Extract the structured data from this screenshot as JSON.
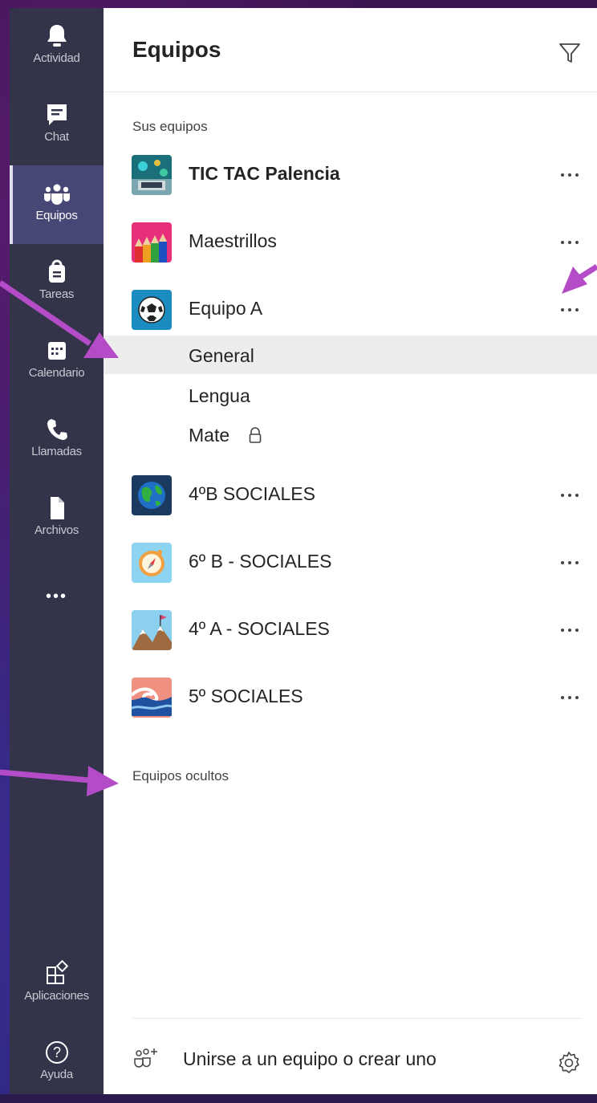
{
  "rail": {
    "items": [
      {
        "label": "Actividad",
        "icon": "bell-icon"
      },
      {
        "label": "Chat",
        "icon": "chat-icon"
      },
      {
        "label": "Equipos",
        "icon": "teams-icon"
      },
      {
        "label": "Tareas",
        "icon": "assignments-icon"
      },
      {
        "label": "Calendario",
        "icon": "calendar-icon"
      },
      {
        "label": "Llamadas",
        "icon": "phone-icon"
      },
      {
        "label": "Archivos",
        "icon": "file-icon"
      }
    ],
    "more_label": "•••",
    "bottom": [
      {
        "label": "Aplicaciones",
        "icon": "apps-icon"
      },
      {
        "label": "Ayuda",
        "icon": "help-icon"
      }
    ]
  },
  "panel": {
    "title": "Equipos",
    "your_teams_label": "Sus equipos",
    "teams": [
      {
        "name": "TIC TAC Palencia",
        "avatar": "tech-avatar"
      },
      {
        "name": "Maestrillos",
        "avatar": "pencils-avatar"
      },
      {
        "name": "Equipo A",
        "avatar": "soccer-avatar"
      }
    ],
    "channels": [
      {
        "name": "General"
      },
      {
        "name": "Lengua"
      },
      {
        "name": "Mate"
      }
    ],
    "teams_more": [
      {
        "name": "4ºB SOCIALES",
        "avatar": "globe-avatar"
      },
      {
        "name": "6º B - SOCIALES",
        "avatar": "compass-avatar"
      },
      {
        "name": "4º A - SOCIALES",
        "avatar": "mountain-avatar"
      },
      {
        "name": "5º SOCIALES",
        "avatar": "wave-avatar"
      }
    ],
    "hidden_teams_label": "Equipos ocultos",
    "join_label": "Unirse a un equipo o crear uno",
    "more_glyph": "•••"
  },
  "colors": {
    "rail_bg": "#33344a",
    "rail_active": "#464775",
    "arrow": "#b44cc8"
  }
}
